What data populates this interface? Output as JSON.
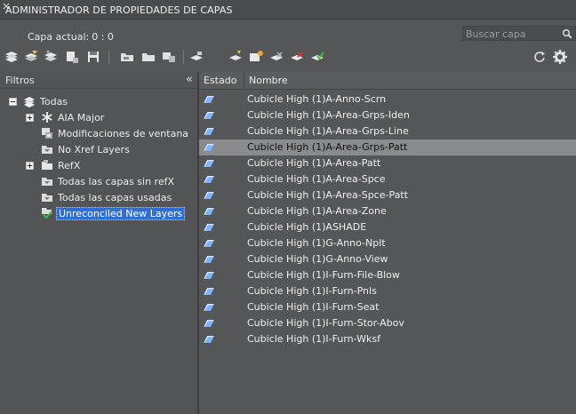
{
  "window": {
    "title": "ADMINISTRADOR DE PROPIEDADES DE CAPAS"
  },
  "current_layer": {
    "label": "Capa actual:",
    "value": "0 : 0"
  },
  "search": {
    "placeholder": "Buscar capa"
  },
  "filters": {
    "header": "Filtros",
    "tree": [
      {
        "label": "Todas",
        "level": 0,
        "icon": "layers-stack-icon",
        "expander": "minus"
      },
      {
        "label": "AIA Major",
        "level": 1,
        "icon": "asterisk-filter-icon",
        "expander": "plus"
      },
      {
        "label": "Modificaciones de ventana",
        "level": 1,
        "icon": "viewport-filter-icon",
        "expander": "none"
      },
      {
        "label": "No Xref Layers",
        "level": 1,
        "icon": "layer-filter-icon",
        "expander": "none"
      },
      {
        "label": "RefX",
        "level": 1,
        "icon": "xref-folder-icon",
        "expander": "plus"
      },
      {
        "label": "Todas las capas sin refX",
        "level": 1,
        "icon": "layer-filter-icon",
        "expander": "none"
      },
      {
        "label": "Todas las capas usadas",
        "level": 1,
        "icon": "layer-filter-icon",
        "expander": "none"
      },
      {
        "label": "Unreconciled New Layers",
        "level": 1,
        "icon": "unreconciled-filter-icon",
        "expander": "none",
        "selected": true
      }
    ]
  },
  "grid": {
    "columns": [
      "Estado",
      "Nombre"
    ],
    "rows": [
      {
        "name": "Cubicle High (1)A-Anno-Scrn"
      },
      {
        "name": "Cubicle High (1)A-Area-Grps-Iden"
      },
      {
        "name": "Cubicle High (1)A-Area-Grps-Line"
      },
      {
        "name": "Cubicle High (1)A-Area-Grps-Patt",
        "selected": true
      },
      {
        "name": "Cubicle High (1)A-Area-Patt"
      },
      {
        "name": "Cubicle High (1)A-Area-Spce"
      },
      {
        "name": "Cubicle High (1)A-Area-Spce-Patt"
      },
      {
        "name": "Cubicle High (1)A-Area-Zone"
      },
      {
        "name": "Cubicle High (1)ASHADE"
      },
      {
        "name": "Cubicle High (1)G-Anno-Nplt"
      },
      {
        "name": "Cubicle High (1)G-Anno-View"
      },
      {
        "name": "Cubicle High (1)I-Furn-File-Blow"
      },
      {
        "name": "Cubicle High (1)I-Furn-Pnls"
      },
      {
        "name": "Cubicle High (1)I-Furn-Seat"
      },
      {
        "name": "Cubicle High (1)I-Furn-Stor-Abov"
      },
      {
        "name": "Cubicle High (1)I-Furn-Wksf"
      }
    ]
  },
  "colors": {
    "background": "#555658",
    "selection_row": "#8a8b8d",
    "selection_filter": "#2f6fd1",
    "layer_icon": "#7fb2ff"
  },
  "toolbar": {
    "left_tools": [
      "new-property-filter-icon",
      "new-group-filter-icon",
      "layer-states-icon",
      "layer-settings-icon",
      "save-icon",
      "open-folder-icon",
      "folder-icon",
      "layer-translate-icon",
      "layer-list-icon",
      "new-layer-icon",
      "new-layer-vp-frozen-icon",
      "delete-layer-icon",
      "delete-layer-red-icon",
      "set-current-icon"
    ],
    "right_tools": [
      "refresh-icon",
      "settings-gear-icon"
    ]
  }
}
